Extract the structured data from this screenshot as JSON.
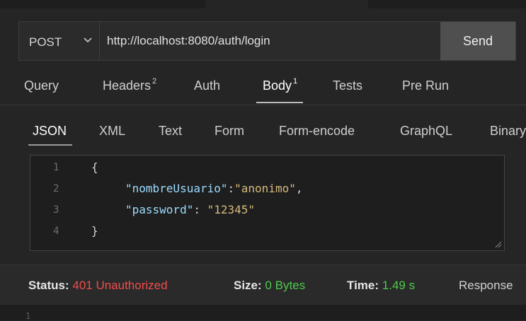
{
  "request": {
    "method": "POST",
    "url": "http://localhost:8080/auth/login",
    "send_label": "Send"
  },
  "tabs": [
    {
      "label": "Query",
      "badge": ""
    },
    {
      "label": "Headers",
      "badge": "2"
    },
    {
      "label": "Auth",
      "badge": ""
    },
    {
      "label": "Body",
      "badge": "1"
    },
    {
      "label": "Tests",
      "badge": ""
    },
    {
      "label": "Pre Run",
      "badge": ""
    }
  ],
  "active_tab": "Body",
  "body_tabs": [
    "JSON",
    "XML",
    "Text",
    "Form",
    "Form-encode",
    "GraphQL",
    "Binary"
  ],
  "active_body_tab": "JSON",
  "editor": {
    "line_numbers": [
      "1",
      "2",
      "3",
      "4"
    ],
    "lines": {
      "l1": "{",
      "l2_key": "\"nombreUsuario\"",
      "l2_sep": ":",
      "l2_val": "\"anonimo\"",
      "l2_end": ",",
      "l3_key": "\"password\"",
      "l3_sep": ": ",
      "l3_val": "\"12345\"",
      "l4": "}"
    }
  },
  "status": {
    "status_label": "Status:",
    "status_value": "401 Unauthorized",
    "size_label": "Size:",
    "size_value": "0 Bytes",
    "time_label": "Time:",
    "time_value": "1.49 s",
    "response_label": "Response"
  },
  "response_body": {
    "first_line_number": "1"
  },
  "colors": {
    "error": "#f14c4c",
    "success": "#4ec94e",
    "json_key": "#9cdcfe",
    "json_string": "#ce9178"
  }
}
